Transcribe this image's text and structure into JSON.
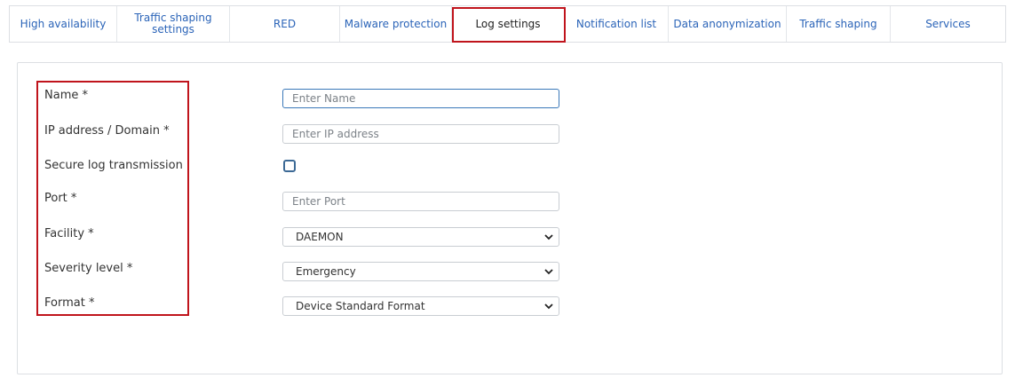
{
  "tabs": [
    {
      "label": "High availability"
    },
    {
      "label": "Traffic shaping\nsettings"
    },
    {
      "label": "RED"
    },
    {
      "label": "Malware protection"
    },
    {
      "label": "Log settings",
      "active": true
    },
    {
      "label": "Notification list"
    },
    {
      "label": "Data anonymization"
    },
    {
      "label": "Traffic shaping"
    },
    {
      "label": "Services"
    }
  ],
  "form": {
    "name": {
      "label": "Name *",
      "placeholder": "Enter Name"
    },
    "ip": {
      "label": "IP address / Domain *",
      "placeholder": "Enter IP address"
    },
    "secure": {
      "label": "Secure log transmission",
      "checked": false
    },
    "port": {
      "label": "Port *",
      "placeholder": "Enter Port"
    },
    "facility": {
      "label": "Facility *",
      "value": "DAEMON"
    },
    "severity": {
      "label": "Severity level *",
      "value": "Emergency"
    },
    "format": {
      "label": "Format *",
      "value": "Device Standard Format"
    }
  },
  "colors": {
    "highlight": "#c0141c",
    "tab_text": "#2b64b8",
    "focus_border": "#3a78b9"
  }
}
